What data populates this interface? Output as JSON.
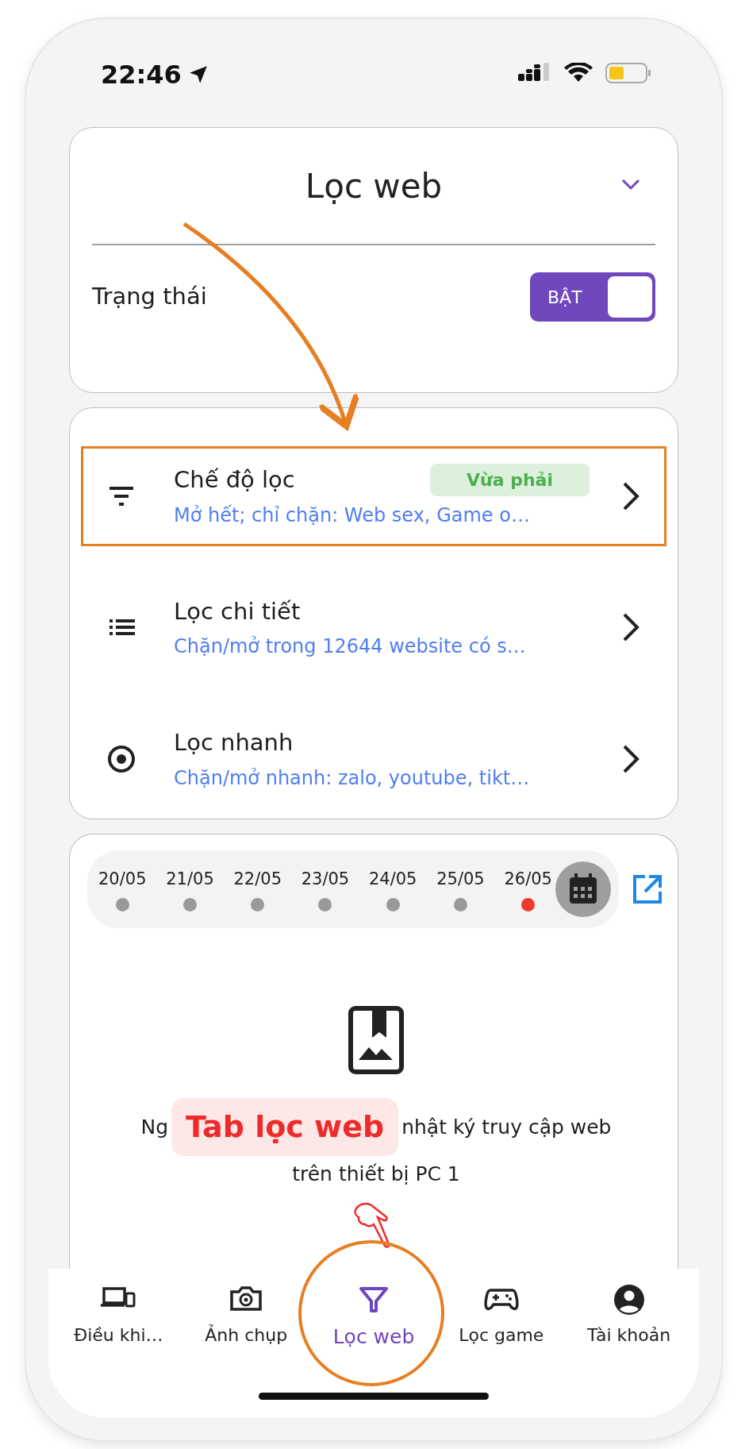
{
  "status_bar": {
    "time": "22:46"
  },
  "filter_card": {
    "title": "Lọc web",
    "status_label": "Trạng thái",
    "toggle": {
      "label": "BẬT",
      "on": true
    }
  },
  "menu": [
    {
      "kind": "filter",
      "title": "Chế độ lọc",
      "badge": "Vừa phải",
      "subtitle": "Mở hết; chỉ chặn: Web sex, Game o…",
      "highlighted": true
    },
    {
      "kind": "list",
      "title": "Lọc chi tiết",
      "subtitle": "Chặn/mở trong 12644 website có s…",
      "highlighted": false
    },
    {
      "kind": "radio",
      "title": "Lọc nhanh",
      "subtitle": "Chặn/mở nhanh: zalo, youtube, tikt…",
      "highlighted": false
    }
  ],
  "history": {
    "dates": [
      {
        "label": "20/05",
        "selected": false
      },
      {
        "label": "21/05",
        "selected": false
      },
      {
        "label": "22/05",
        "selected": false
      },
      {
        "label": "23/05",
        "selected": false
      },
      {
        "label": "24/05",
        "selected": false
      },
      {
        "label": "25/05",
        "selected": false
      },
      {
        "label": "26/05",
        "selected": true
      }
    ],
    "empty_text_start": "Ng",
    "empty_text_end": "nhật ký truy cập web",
    "empty_text_line2": "trên thiết bị PC 1"
  },
  "callout": "Tab lọc web",
  "nav": [
    {
      "kind": "devices",
      "label": "Điều khi…",
      "selected": false
    },
    {
      "kind": "camera",
      "label": "Ảnh chụp",
      "selected": false
    },
    {
      "kind": "filter",
      "label": "Lọc web",
      "selected": true
    },
    {
      "kind": "game",
      "label": "Lọc game",
      "selected": false
    },
    {
      "kind": "account",
      "label": "Tài khoản",
      "selected": false
    }
  ]
}
